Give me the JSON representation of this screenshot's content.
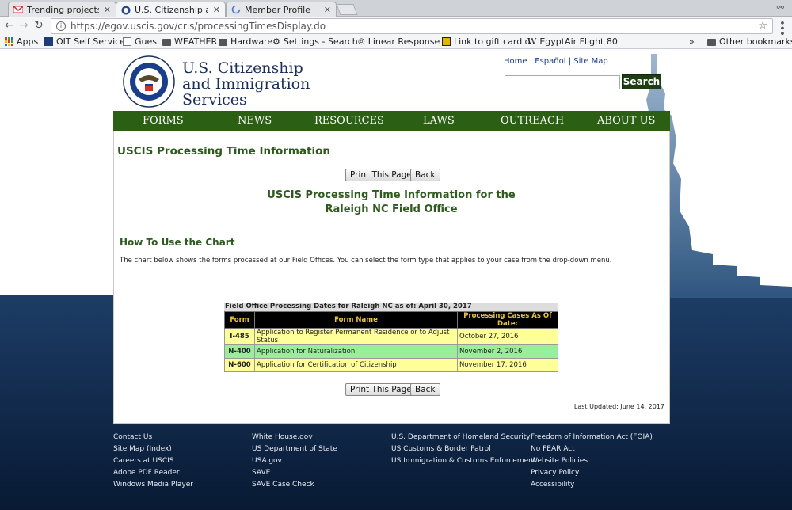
{
  "browser": {
    "tabs": [
      {
        "title": "Trending projects in",
        "icon": "gmail-icon"
      },
      {
        "title": "U.S. Citizenship and",
        "icon": "dhs-seal-icon",
        "active": true
      },
      {
        "title": "Member Profile",
        "icon": "loading-icon"
      }
    ],
    "url": "https://egov.uscis.gov/cris/processingTimesDisplay.do",
    "bookmarks": [
      {
        "label": "Apps",
        "icon": "apps-grid-icon"
      },
      {
        "label": "OIT Self Service",
        "icon": "oit-icon"
      },
      {
        "label": "Guest",
        "icon": "page-icon"
      },
      {
        "label": "WEATHER",
        "icon": "folder-icon"
      },
      {
        "label": "Hardware",
        "icon": "folder-icon"
      },
      {
        "label": "Settings - Search",
        "icon": "gear-icon"
      },
      {
        "label": "Linear Response",
        "icon": "linear-icon"
      },
      {
        "label": "Link to gift card d",
        "icon": "gift-icon"
      },
      {
        "label": "EgyptAir Flight 80",
        "icon": "wikipedia-icon"
      }
    ],
    "more_bookmarks": "»",
    "other_bookmarks": "Other bookmarks"
  },
  "header": {
    "agency_line1": "U.S. Citizenship",
    "agency_line2": "and Immigration",
    "agency_line3": "Services",
    "link_home": "Home",
    "link_espanol": "Español",
    "link_sitemap": "Site Map",
    "sep": "|",
    "search_button": "Search"
  },
  "nav": [
    "FORMS",
    "NEWS",
    "RESOURCES",
    "LAWS",
    "OUTREACH",
    "ABOUT US"
  ],
  "content": {
    "page_title": "USCIS Processing Time Information",
    "print_button": "Print This Page",
    "back_button": "Back",
    "subtitle_line1": "USCIS Processing Time Information for the",
    "subtitle_line2": "Raleigh NC Field Office",
    "howto_heading": "How To Use the Chart",
    "howto_text": "The chart below shows the forms processed at our Field Offices. You can select the form type that applies to your case from the drop-down menu.",
    "table_caption": "Field Office Processing Dates for Raleigh NC as of: April 30, 2017",
    "table_headers": [
      "Form",
      "Form Name",
      "Processing Cases As Of Date:"
    ],
    "table_rows": [
      {
        "form": "I-485",
        "name": "Application to Register Permanent Residence or to Adjust Status",
        "date": "October 27, 2016"
      },
      {
        "form": "N-400",
        "name": "Application for Naturalization",
        "date": "November 2, 2016"
      },
      {
        "form": "N-600",
        "name": "Application for Certification of Citizenship",
        "date": "November 17, 2016"
      }
    ],
    "last_updated": "Last Updated: June 14, 2017"
  },
  "footer": {
    "col1": [
      "Contact Us",
      "Site Map (Index)",
      "Careers at USCIS",
      "Adobe PDF Reader",
      "Windows Media Player"
    ],
    "col2": [
      "White House.gov",
      "US Department of State",
      "USA.gov",
      "SAVE",
      "SAVE Case Check"
    ],
    "col3": [
      "U.S. Department of Homeland Security",
      "US Customs & Border Patrol",
      "US Immigration & Customs Enforcement"
    ],
    "col4": [
      "Freedom of Information Act (FOIA)",
      "No FEAR Act",
      "Website Policies",
      "Privacy Policy",
      "Accessibility"
    ]
  }
}
